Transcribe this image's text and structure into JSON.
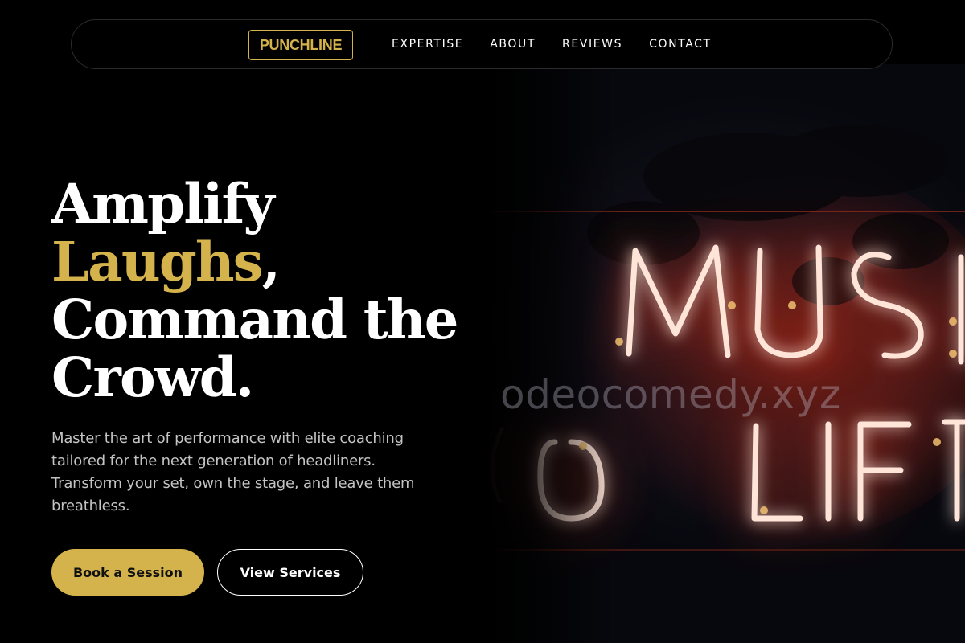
{
  "nav": {
    "logo": "PUNCHLINE",
    "links": [
      "EXPERTISE",
      "ABOUT",
      "REVIEWS",
      "CONTACT"
    ]
  },
  "hero": {
    "headline_line1": "Amplify",
    "headline_accent": "Laughs",
    "headline_comma": ",",
    "headline_line3": "Command the",
    "headline_line4": "Crowd.",
    "subtext": "Master the art of performance with elite coaching tailored for the next generation of headliners. Transform your set, own the stage, and leave them breathless.",
    "primary_button": "Book a Session",
    "secondary_button": "View Services",
    "image_watermark": "odeocomedy.xyz"
  },
  "colors": {
    "background": "#000000",
    "accent_gold": "#d4b24c",
    "text_white": "#ffffff",
    "text_muted": "#c4c4c4",
    "neon_red": "#ff5a3a"
  },
  "icons": {
    "hero_image": "neon-sign-photo"
  }
}
